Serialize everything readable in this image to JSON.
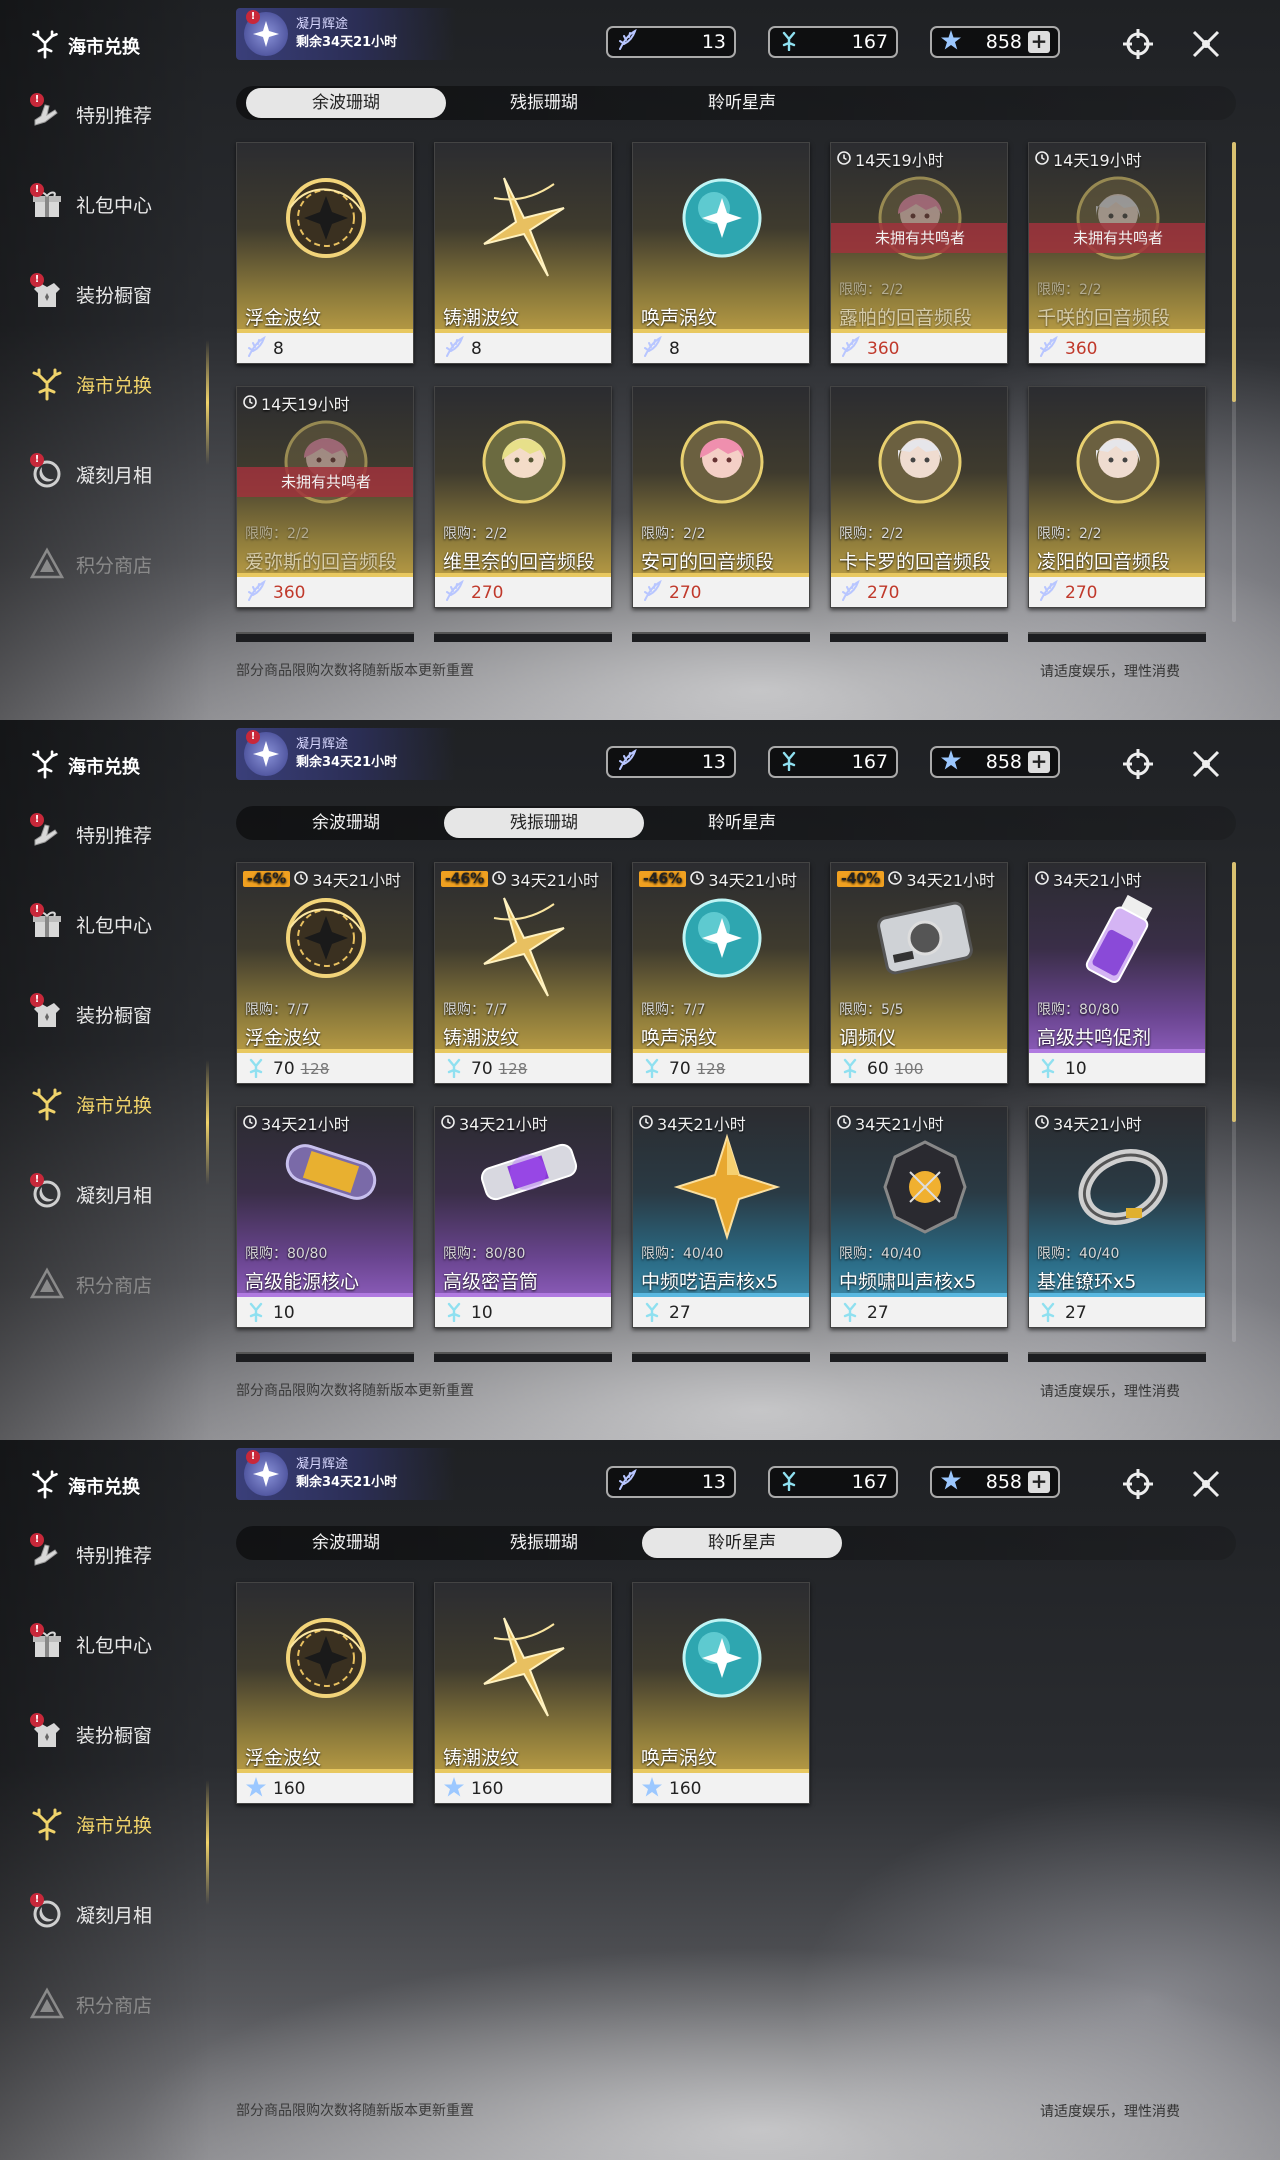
{
  "sidebar": {
    "title": "海市兑换",
    "items": [
      {
        "label": "特别推荐",
        "icon": "hand-icon",
        "badge": "!"
      },
      {
        "label": "礼包中心",
        "icon": "gift-icon",
        "badge": "!"
      },
      {
        "label": "装扮橱窗",
        "icon": "outfit-icon",
        "badge": "!"
      },
      {
        "label": "海市兑换",
        "icon": "coral-icon",
        "badge": ""
      },
      {
        "label": "凝刻月相",
        "icon": "moon-icon",
        "badge": "!"
      },
      {
        "label": "积分商店",
        "icon": "triangle-icon",
        "badge": ""
      }
    ]
  },
  "event": {
    "title": "凝月辉途",
    "remaining": "剩余34天21小时",
    "badge": "!"
  },
  "currencies": [
    {
      "name": "wave-coral",
      "icon": "coral-feather-icon",
      "value": "13"
    },
    {
      "name": "echo-coral",
      "icon": "coral-blue-icon",
      "value": "167"
    },
    {
      "name": "star-sound",
      "icon": "star-icon",
      "value": "858",
      "plus": "+"
    }
  ],
  "tabs": [
    "余波珊瑚",
    "残振珊瑚",
    "聆听星声"
  ],
  "footer": {
    "left": "部分商品限购次数将随新版本更新重置",
    "right": "请适度娱乐，理性消费"
  },
  "colors": {
    "accent": "#f0d36a",
    "discount": "#f0a020",
    "locked": "#a0323c"
  },
  "panels": [
    {
      "selected_tab": 0,
      "items": [
        {
          "name": "浮金波纹",
          "price": "8",
          "rarity": "gold",
          "art": "gold-orb",
          "currency_icon": "coral-feather-icon"
        },
        {
          "name": "铸潮波纹",
          "price": "8",
          "rarity": "gold",
          "art": "gold-blade",
          "currency_icon": "coral-feather-icon"
        },
        {
          "name": "唤声涡纹",
          "price": "8",
          "rarity": "gold",
          "art": "teal-orb",
          "currency_icon": "coral-feather-icon"
        },
        {
          "name": "露帕的回音频段",
          "price": "360",
          "price_red": true,
          "rarity": "gold",
          "art": "portrait-pink",
          "timer": "14天19小时",
          "limit": "限购：2/2",
          "banner": "未拥有共鸣者",
          "currency_icon": "coral-feather-icon"
        },
        {
          "name": "千咲的回音频段",
          "price": "360",
          "price_red": true,
          "rarity": "gold",
          "art": "portrait-white",
          "timer": "14天19小时",
          "limit": "限购：2/2",
          "banner": "未拥有共鸣者",
          "currency_icon": "coral-feather-icon"
        },
        {
          "name": "爱弥斯的回音频段",
          "price": "360",
          "price_red": true,
          "rarity": "gold",
          "art": "portrait-pink",
          "timer": "14天19小时",
          "limit": "限购：2/2",
          "banner": "未拥有共鸣者",
          "currency_icon": "coral-feather-icon"
        },
        {
          "name": "维里奈的回音频段",
          "price": "270",
          "price_red": true,
          "rarity": "gold",
          "art": "portrait-green",
          "limit": "限购：2/2",
          "currency_icon": "coral-feather-icon"
        },
        {
          "name": "安可的回音频段",
          "price": "270",
          "price_red": true,
          "rarity": "gold",
          "art": "portrait-pink",
          "limit": "限购：2/2",
          "currency_icon": "coral-feather-icon"
        },
        {
          "name": "卡卡罗的回音频段",
          "price": "270",
          "price_red": true,
          "rarity": "gold",
          "art": "portrait-white",
          "limit": "限购：2/2",
          "currency_icon": "coral-feather-icon"
        },
        {
          "name": "凌阳的回音频段",
          "price": "270",
          "price_red": true,
          "rarity": "gold",
          "art": "portrait-white",
          "limit": "限购：2/2",
          "currency_icon": "coral-feather-icon"
        }
      ]
    },
    {
      "selected_tab": 1,
      "items": [
        {
          "name": "浮金波纹",
          "price": "70",
          "old_price": "128",
          "discount": "-46%",
          "timer": "34天21小时",
          "limit": "限购：7/7",
          "rarity": "gold",
          "art": "gold-orb",
          "currency_icon": "coral-blue-icon"
        },
        {
          "name": "铸潮波纹",
          "price": "70",
          "old_price": "128",
          "discount": "-46%",
          "timer": "34天21小时",
          "limit": "限购：7/7",
          "rarity": "gold",
          "art": "gold-blade",
          "currency_icon": "coral-blue-icon"
        },
        {
          "name": "唤声涡纹",
          "price": "70",
          "old_price": "128",
          "discount": "-46%",
          "timer": "34天21小时",
          "limit": "限购：7/7",
          "rarity": "gold",
          "art": "teal-orb",
          "currency_icon": "coral-blue-icon"
        },
        {
          "name": "调频仪",
          "price": "60",
          "old_price": "100",
          "discount": "-40%",
          "timer": "34天21小时",
          "limit": "限购：5/5",
          "rarity": "gold",
          "art": "device",
          "currency_icon": "coral-blue-icon"
        },
        {
          "name": "高级共鸣促剂",
          "price": "10",
          "timer": "34天21小时",
          "limit": "限购：80/80",
          "rarity": "purple",
          "art": "vial",
          "currency_icon": "coral-blue-icon"
        },
        {
          "name": "高级能源核心",
          "price": "10",
          "timer": "34天21小时",
          "limit": "限购：80/80",
          "rarity": "purple",
          "art": "capsule",
          "currency_icon": "coral-blue-icon"
        },
        {
          "name": "高级密音筒",
          "price": "10",
          "timer": "34天21小时",
          "limit": "限购：80/80",
          "rarity": "purple",
          "art": "tube",
          "currency_icon": "coral-blue-icon"
        },
        {
          "name": "中频呓语声核x5",
          "price": "27",
          "timer": "34天21小时",
          "limit": "限购：40/40",
          "rarity": "blue",
          "art": "star-core",
          "currency_icon": "coral-blue-icon"
        },
        {
          "name": "中频啸叫声核x5",
          "price": "27",
          "timer": "34天21小时",
          "limit": "限购：40/40",
          "rarity": "blue",
          "art": "dark-core",
          "currency_icon": "coral-blue-icon"
        },
        {
          "name": "基准镣环x5",
          "price": "27",
          "timer": "34天21小时",
          "limit": "限购：40/40",
          "rarity": "blue",
          "art": "ring",
          "currency_icon": "coral-blue-icon"
        }
      ]
    },
    {
      "selected_tab": 2,
      "items": [
        {
          "name": "浮金波纹",
          "price": "160",
          "rarity": "gold",
          "art": "gold-orb",
          "currency_icon": "star-icon"
        },
        {
          "name": "铸潮波纹",
          "price": "160",
          "rarity": "gold",
          "art": "gold-blade",
          "currency_icon": "star-icon"
        },
        {
          "name": "唤声涡纹",
          "price": "160",
          "rarity": "gold",
          "art": "teal-orb",
          "currency_icon": "star-icon"
        }
      ]
    }
  ]
}
